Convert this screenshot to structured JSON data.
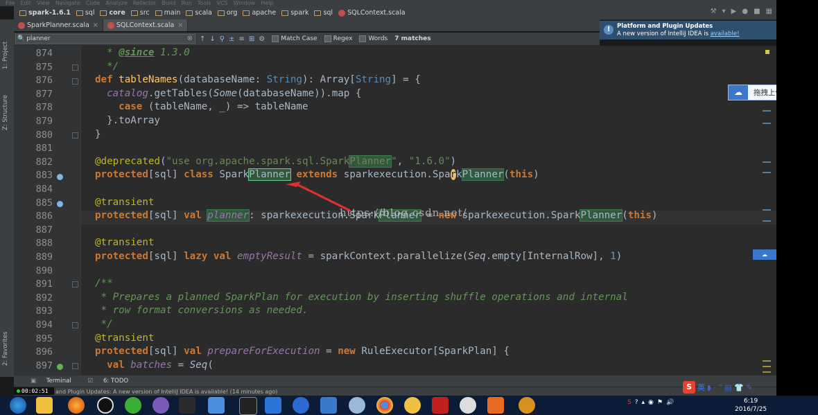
{
  "breadcrumbs": [
    {
      "label": "spark-1.6.1",
      "kind": "project"
    },
    {
      "label": "sql",
      "kind": "folder"
    },
    {
      "label": "core",
      "kind": "folder"
    },
    {
      "label": "src",
      "kind": "folder"
    },
    {
      "label": "main",
      "kind": "folder"
    },
    {
      "label": "scala",
      "kind": "folder"
    },
    {
      "label": "org",
      "kind": "folder"
    },
    {
      "label": "apache",
      "kind": "folder"
    },
    {
      "label": "spark",
      "kind": "folder"
    },
    {
      "label": "sql",
      "kind": "folder"
    },
    {
      "label": "SQLContext.scala",
      "kind": "file"
    }
  ],
  "tabs": [
    {
      "label": "SparkPlanner.scala",
      "active": false
    },
    {
      "label": "SQLContext.scala",
      "active": true
    }
  ],
  "notification": {
    "title": "Platform and Plugin Updates",
    "text": "A new version of IntelliJ IDEA is",
    "link": "available!"
  },
  "search": {
    "value": "planner",
    "match_case_label": "Match Case",
    "regex_label": "Regex",
    "words_label": "Words",
    "matches": "7 matches"
  },
  "side_tools": {
    "project": "1: Project",
    "structure": "Z: Structure",
    "favorites": "2: Favorites"
  },
  "line_numbers": [
    "874",
    "875",
    "876",
    "877",
    "878",
    "879",
    "880",
    "881",
    "882",
    "883",
    "884",
    "885",
    "886",
    "887",
    "888",
    "889",
    "890",
    "891",
    "892",
    "893",
    "894",
    "895",
    "896",
    "897"
  ],
  "code": {
    "l874_a": "* ",
    "l874_tag": "@since",
    "l874_b": " 1.3.0",
    "l875": "*/",
    "l876_kw": "def ",
    "l876_fn": "tableNames",
    "l876_a": "(databaseName: ",
    "l876_t1": "String",
    "l876_b": "): Array[",
    "l876_t2": "String",
    "l876_c": "] = {",
    "l877_it": "catalog",
    "l877_a": ".getTables(",
    "l877_it2": "Some",
    "l877_b": "(databaseName)).map {",
    "l878_kw": "case ",
    "l878_a": "(tableName, _) => tableName",
    "l879": "}.toArray",
    "l880": "}",
    "l882_an": "@deprecated",
    "l882_a": "(",
    "l882_s1": "\"use org.apache.spark.sql.Spark",
    "l882_m": "Planner",
    "l882_s2": "\"",
    "l882_b": ", ",
    "l882_s3": "\"1.6.0\"",
    "l882_c": ")",
    "l883_kw1": "protected",
    "l883_a": "[sql] ",
    "l883_kw2": "class ",
    "l883_b": "Spark",
    "l883_m": "Planner",
    "l883_c": " ",
    "l883_kw3": "extends ",
    "l883_d": "sparkexecution.Spa",
    "l883_cur": "r",
    "l883_e": "k",
    "l883_m2": "Planner",
    "l883_f": "(",
    "l883_kw4": "this",
    "l883_g": ")",
    "l885_an": "@transient",
    "l886_kw1": "protected",
    "l886_a": "[sql] ",
    "l886_kw2": "val ",
    "l886_m": "planner",
    "l886_b": ": sparkexecution.Spark",
    "l886_m2": "Planner",
    "l886_c": " = ",
    "l886_kw3": "new ",
    "l886_d": "sparkexecution.Spark",
    "l886_m3": "Planner",
    "l886_e": "(",
    "l886_kw4": "this",
    "l886_f": ")",
    "l888_an": "@transient",
    "l889_kw1": "protected",
    "l889_a": "[sql] ",
    "l889_kw2": "lazy ",
    "l889_kw3": "val ",
    "l889_it": "emptyResult",
    "l889_b": " = sparkContext.parallelize(",
    "l889_it2": "Seq",
    "l889_c": ".empty[InternalRow], ",
    "l889_num": "1",
    "l889_d": ")",
    "l891": "/**",
    "l892": "* Prepares a planned SparkPlan for execution by inserting shuffle operations and internal",
    "l893": "* row format conversions as needed.",
    "l894": "*/",
    "l895_an": "@transient",
    "l896_kw1": "protected",
    "l896_a": "[sql] ",
    "l896_kw2": "val ",
    "l896_it": "prepareForExecution",
    "l896_b": " = ",
    "l896_kw3": "new ",
    "l896_c": "RuleExecutor[SparkPlan] {",
    "l897_kw": "val ",
    "l897_it": "batches",
    "l897_a": " = ",
    "l897_it2": "Seq",
    "l897_b": "("
  },
  "watermark": "https://blog.csdn.net/",
  "upload_label": "拖拽上传",
  "bottom_tools": {
    "terminal": "Terminal",
    "todo": "6: TODO"
  },
  "status_text": "and Plugin Updates: A new version of IntelliJ IDEA is available! (14 minutes ago)",
  "timer": "00:02:51",
  "ime_label": "英",
  "clock": {
    "time": "6:19",
    "date": "2016/7/25"
  },
  "colors": {
    "accent": "#cc7832",
    "match": "#32593d",
    "notification": "#2f4f6f"
  }
}
